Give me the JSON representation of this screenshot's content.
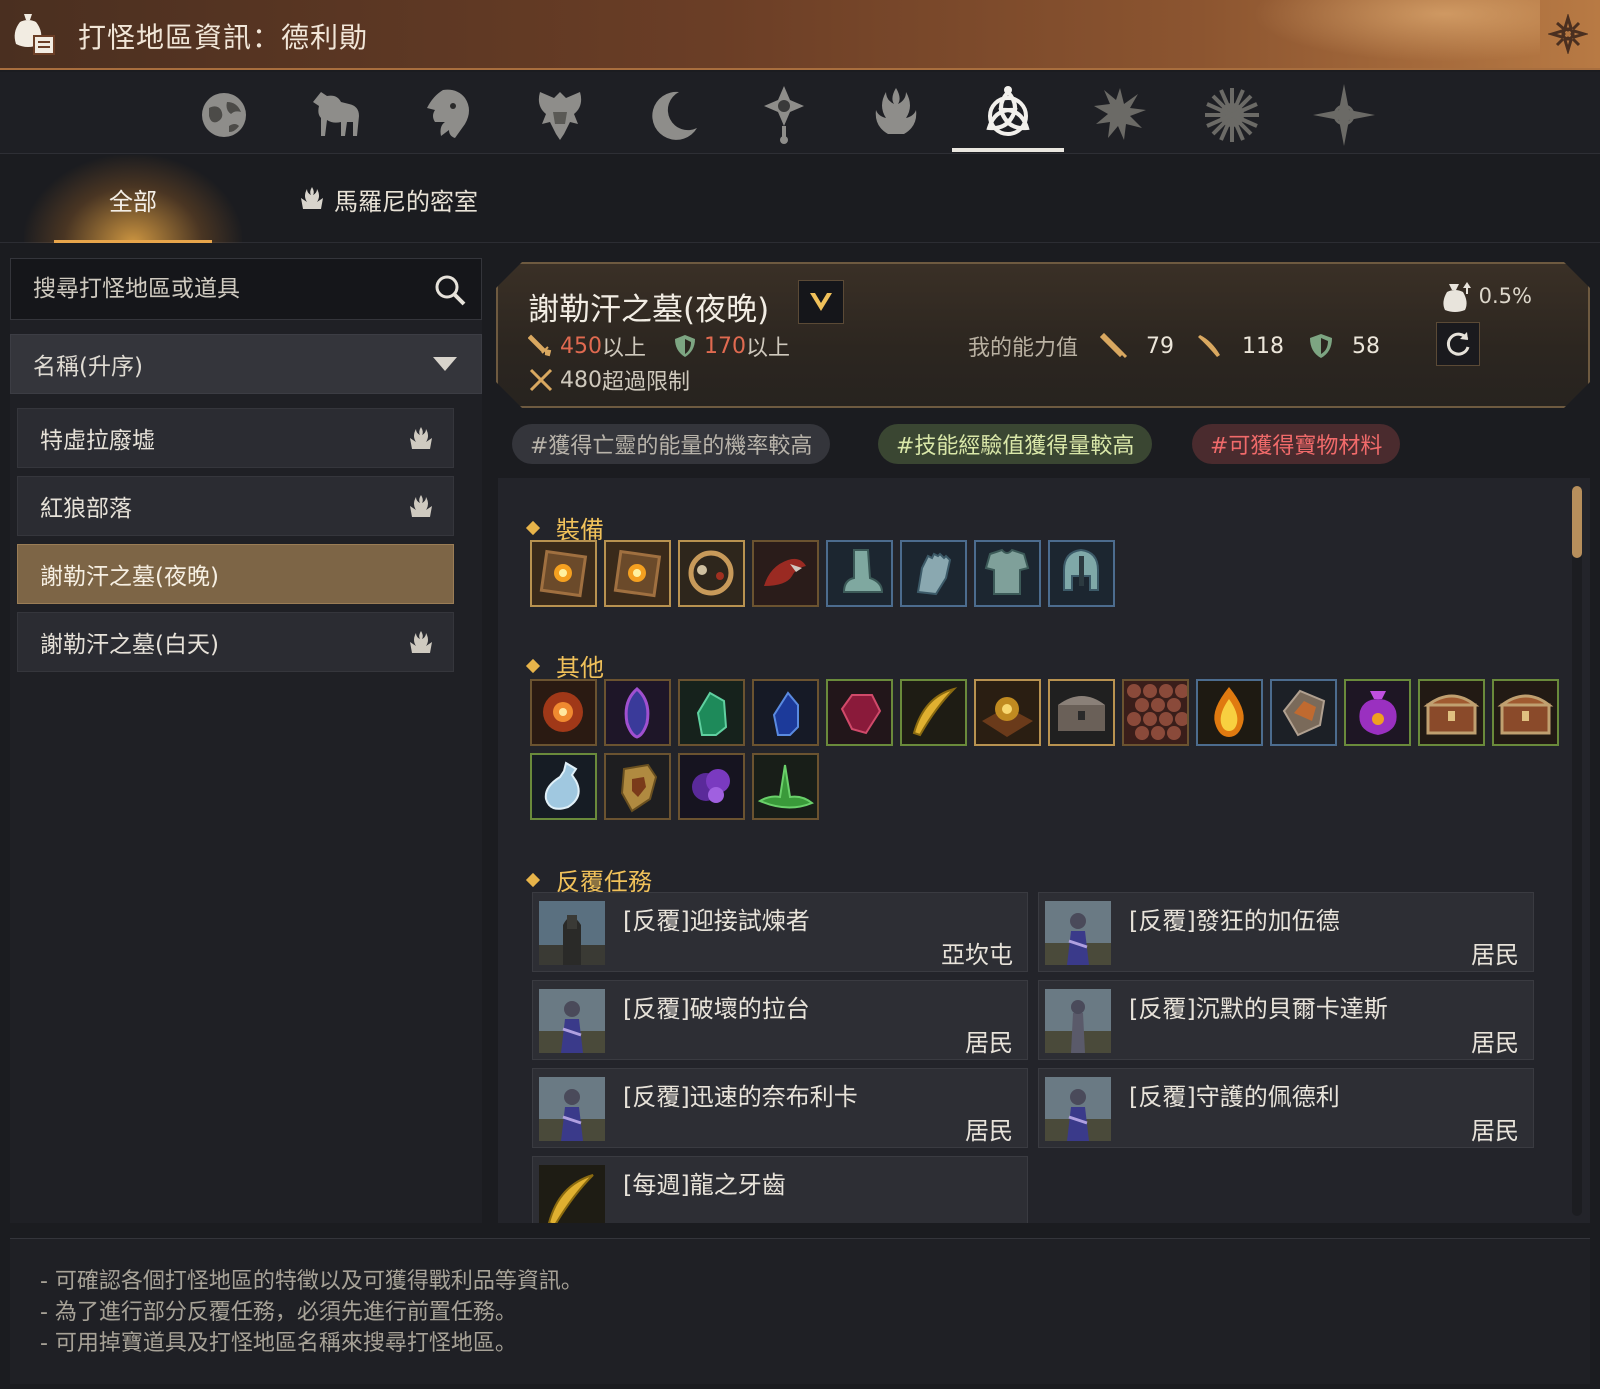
{
  "window": {
    "title": "打怪地區資訊：德利勛"
  },
  "categories": [
    {
      "icon": "globe-icon"
    },
    {
      "icon": "horse-icon"
    },
    {
      "icon": "lion-icon"
    },
    {
      "icon": "eagle-crest-icon"
    },
    {
      "icon": "crescent-moon-icon"
    },
    {
      "icon": "compass-star-icon"
    },
    {
      "icon": "flame-hand-icon"
    },
    {
      "icon": "triquetra-icon",
      "active": true
    },
    {
      "icon": "spiky-star-icon"
    },
    {
      "icon": "sun-burst-icon"
    },
    {
      "icon": "four-point-star-icon"
    }
  ],
  "subtabs": {
    "all": "全部",
    "room": "馬羅尼的密室"
  },
  "search": {
    "placeholder": "搜尋打怪地區或道具"
  },
  "sort": {
    "selected": "名稱(升序)"
  },
  "zones": [
    {
      "name": "特虛拉廢墟",
      "has_room_icon": true
    },
    {
      "name": "紅狼部落",
      "has_room_icon": true
    },
    {
      "name": "謝勒汗之墓(夜晚)",
      "selected": true
    },
    {
      "name": "謝勒汗之墓(白天)",
      "has_room_icon": true
    }
  ],
  "zone_info": {
    "title": "謝勒汗之墓(夜晚)",
    "drop_rate": "0.5%",
    "attack_req_value": "450",
    "attack_req_suffix": "以上",
    "defense_req_value": "170",
    "defense_req_suffix": "以上",
    "cap_value": "480",
    "cap_suffix": "超過限制",
    "my_stats_label": "我的能力值",
    "my_ap": "79",
    "my_awk_ap": "118",
    "my_dp": "58"
  },
  "tags": {
    "tag1": "#獲得亡靈的能量的機率較高",
    "tag2": "#技能經驗值獲得量較高",
    "tag3": "#可獲得寶物材料"
  },
  "sections": {
    "equipment": "裝備",
    "other": "其他",
    "quests": "反覆任務"
  },
  "equipment_items": [
    "belt-icon",
    "belt-icon",
    "necklace-icon",
    "red-shoe-icon",
    "boots-icon",
    "gloves-icon",
    "armor-icon",
    "helmet-icon"
  ],
  "other_items": [
    "fire-burst-icon",
    "purple-crystal-icon",
    "green-crystal-icon",
    "blue-crystal-icon",
    "red-gem-icon",
    "golden-fang-icon",
    "gold-orb-icon",
    "treasure-chest-icon",
    "scale-icon",
    "fire-drop-icon",
    "shard-icon",
    "purple-pouch-icon",
    "chest-icon",
    "chest-icon",
    "potion-icon",
    "shield-icon",
    "purple-cloud-icon",
    "green-cone-icon"
  ],
  "quests": [
    {
      "name": "[反覆]迎接試煉者",
      "giver": "亞坎屯"
    },
    {
      "name": "[反覆]發狂的加伍德",
      "giver": "居民"
    },
    {
      "name": "[反覆]破壞的拉台",
      "giver": "居民"
    },
    {
      "name": "[反覆]沉默的貝爾卡達斯",
      "giver": "居民"
    },
    {
      "name": "[反覆]迅速的奈布利卡",
      "giver": "居民"
    },
    {
      "name": "[反覆]守護的佩德利",
      "giver": "居民"
    },
    {
      "name": "[每週]龍之牙齒",
      "giver": ""
    }
  ],
  "footer": {
    "line1": "- 可確認各個打怪地區的特徵以及可獲得戰利品等資訊。",
    "line2": "- 為了進行部分反覆任務，必須先進行前置任務。",
    "line3": "- 可用掉寶道具及打怪地區名稱來搜尋打怪地區。"
  },
  "colors": {
    "accent": "#e8a54b",
    "selected_zone": "#7d6546",
    "section_title": "#f0c15a",
    "red_value": "#e06a50",
    "yellow_value": "#f0c23c"
  }
}
